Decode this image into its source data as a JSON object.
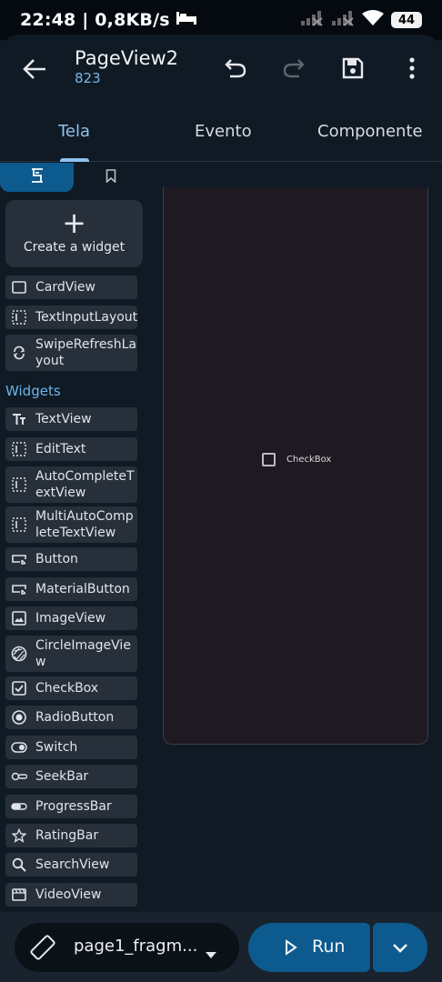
{
  "status_bar": {
    "time_speed": "22:48 | 0,8KB/s",
    "battery": "44",
    "icons": [
      "bed-icon",
      "signal-off-icon",
      "signal-off-icon",
      "wifi-icon",
      "battery-icon"
    ]
  },
  "app_bar": {
    "title": "PageView2",
    "subtitle": "823",
    "icons": [
      "back-arrow-icon",
      "undo-icon",
      "redo-icon",
      "save-icon",
      "more-vert-icon"
    ]
  },
  "tabs": [
    {
      "label": "Tela",
      "active": true
    },
    {
      "label": "Evento",
      "active": false
    },
    {
      "label": "Componente",
      "active": false
    }
  ],
  "palette": {
    "tabs": [
      "widgets-tab-icon",
      "bookmark-icon"
    ],
    "create_label": "Create a widget",
    "layouts": [
      {
        "label": "CardView",
        "icon": "card-icon"
      },
      {
        "label": "TextInputLayout",
        "icon": "dashed-box-icon"
      },
      {
        "label": "SwipeRefreshLa\nyout",
        "icon": "refresh-icon"
      }
    ],
    "widgets_header": "Widgets",
    "widgets": [
      {
        "label": "TextView",
        "icon": "text-icon"
      },
      {
        "label": "EditText",
        "icon": "dashed-box-icon"
      },
      {
        "label": "AutoCompleteT\nextView",
        "icon": "dashed-box-icon"
      },
      {
        "label": "MultiAutoComp\nleteTextView",
        "icon": "dashed-box-icon"
      },
      {
        "label": "Button",
        "icon": "button-icon"
      },
      {
        "label": "MaterialButton",
        "icon": "button-icon"
      },
      {
        "label": "ImageView",
        "icon": "image-icon"
      },
      {
        "label": "CircleImageVie\nw",
        "icon": "circle-image-icon"
      },
      {
        "label": "CheckBox",
        "icon": "checkbox-icon"
      },
      {
        "label": "RadioButton",
        "icon": "radio-icon"
      },
      {
        "label": "Switch",
        "icon": "switch-icon"
      },
      {
        "label": "SeekBar",
        "icon": "seekbar-icon"
      },
      {
        "label": "ProgressBar",
        "icon": "progressbar-icon"
      },
      {
        "label": "RatingBar",
        "icon": "star-icon"
      },
      {
        "label": "SearchView",
        "icon": "search-icon"
      },
      {
        "label": "VideoView",
        "icon": "video-icon"
      }
    ]
  },
  "canvas": {
    "checkbox_label": "CheckBox"
  },
  "bottom_bar": {
    "page_name": "page1_fragm...",
    "run_label": "Run",
    "icons": [
      "rotate-icon",
      "dropdown-icon",
      "play-icon",
      "chevron-down-icon"
    ]
  },
  "colors": {
    "background": "#0f1a24",
    "accent": "#0d5a8f",
    "accent_text": "#8ec3f0",
    "item_bg": "#27303a",
    "canvas_bg": "#1f1a22"
  }
}
